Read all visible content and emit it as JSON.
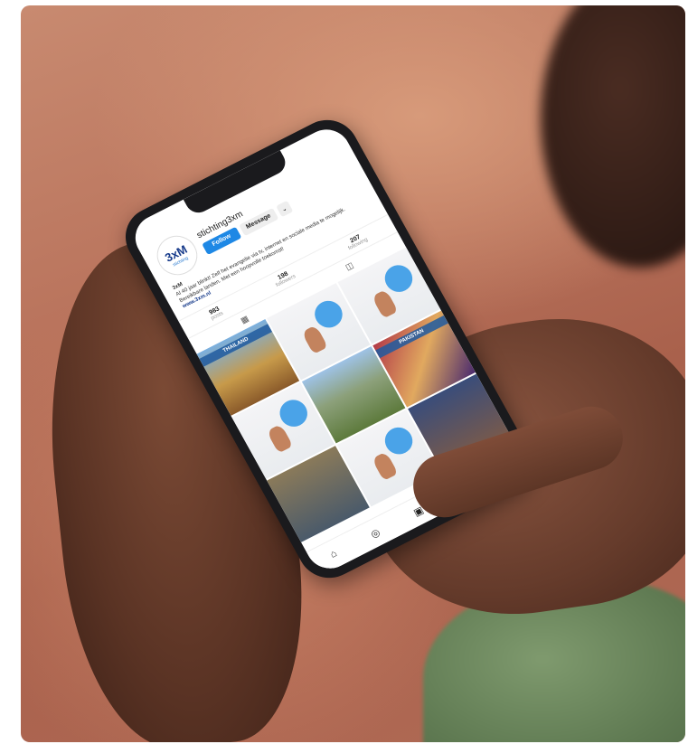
{
  "profile": {
    "username": "stichting3xm",
    "logo_text": "3xM",
    "logo_sub": "stichting",
    "follow_label": "Follow",
    "message_label": "Message",
    "bio_name": "3xM",
    "bio_text": "Al 40 jaar blinkt! Zelf het evangelie via tv, internet en sociale media te mogelijk. Bereikbare landen. Met een hoopvolle toekomst!",
    "link": "www.3xm.nl"
  },
  "stats": [
    {
      "value": "983",
      "label": "posts"
    },
    {
      "value": "198",
      "label": "followers"
    },
    {
      "value": "207",
      "label": "following"
    }
  ],
  "tiles": [
    {
      "text": "THAILAND"
    },
    {
      "text": ""
    },
    {
      "text": ""
    },
    {
      "text": ""
    },
    {
      "text": ""
    },
    {
      "text": "PAKISTAN"
    },
    {
      "text": ""
    },
    {
      "text": ""
    },
    {
      "text": ""
    }
  ],
  "icons": {
    "grid_tab": "grid-icon",
    "tagged_tab": "tagged-icon",
    "nav": [
      "home-icon",
      "explore-icon",
      "reels-icon",
      "shop-icon",
      "profile-icon"
    ]
  }
}
